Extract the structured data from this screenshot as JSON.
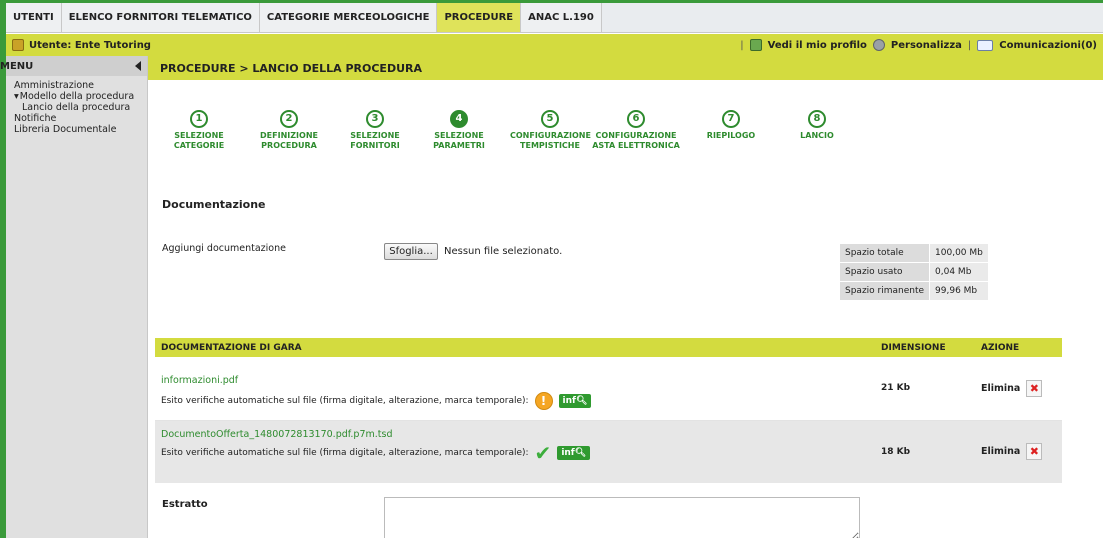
{
  "topnav": {
    "tabs": [
      {
        "label": "UTENTI",
        "active": false
      },
      {
        "label": "ELENCO FORNITORI TELEMATICO",
        "active": false
      },
      {
        "label": "CATEGORIE MERCEOLOGICHE",
        "active": false
      },
      {
        "label": "PROCEDURE",
        "active": true
      },
      {
        "label": "ANAC L.190",
        "active": false
      }
    ]
  },
  "userbar": {
    "user": "Utente: Ente Tutoring",
    "profile_link": "Vedi il mio profilo",
    "customize_link": "Personalizza",
    "messages_link": "Comunicazioni(0)",
    "separator": "|"
  },
  "sidebar": {
    "title": "MENU",
    "items": [
      {
        "label": "Amministrazione"
      },
      {
        "label": "Modello della procedura"
      },
      {
        "label": "Lancio della procedura"
      },
      {
        "label": "Notifiche"
      },
      {
        "label": "Libreria Documentale"
      }
    ]
  },
  "breadcrumb": "PROCEDURE  > LANCIO DELLA PROCEDURA",
  "steps": [
    {
      "num": "1",
      "label": "SELEZIONE CATEGORIE"
    },
    {
      "num": "2",
      "label": "DEFINIZIONE PROCEDURA"
    },
    {
      "num": "3",
      "label": "SELEZIONE FORNITORI"
    },
    {
      "num": "4",
      "label": "SELEZIONE PARAMETRI",
      "active": true
    },
    {
      "num": "5",
      "label": "CONFIGURAZIONE TEMPISTICHE"
    },
    {
      "num": "6",
      "label": "CONFIGURAZIONE ASTA ELETTRONICA"
    },
    {
      "num": "7",
      "label": "RIEPILOGO"
    },
    {
      "num": "8",
      "label": "LANCIO"
    }
  ],
  "documentation": {
    "title": "Documentazione",
    "add_label": "Aggiungi documentazione",
    "browse_button": "Sfoglia...",
    "file_status": "Nessun file selezionato."
  },
  "space": {
    "rows": [
      {
        "key": "Spazio totale",
        "value": "100,00 Mb"
      },
      {
        "key": "Spazio usato",
        "value": "0,04 Mb"
      },
      {
        "key": "Spazio rimanente",
        "value": "99,96 Mb"
      }
    ]
  },
  "docs_table": {
    "headers": [
      "DOCUMENTAZIONE DI GARA",
      "DIMENSIONE",
      "AZIONE"
    ],
    "rows": [
      {
        "filename": "informazioni.pdf",
        "esito": "Esito verifiche automatiche sul file (firma digitale, alterazione, marca temporale):",
        "status": "warning",
        "info": "inf",
        "size": "21 Kb",
        "action": "Elimina"
      },
      {
        "filename": "DocumentoOfferta_1480072813170.pdf.p7m.tsd",
        "esito": "Esito verifiche automatiche sul file (firma digitale, alterazione, marca temporale):",
        "status": "ok",
        "info": "inf",
        "size": "18 Kb",
        "action": "Elimina"
      }
    ]
  },
  "estratto": {
    "label": "Estratto",
    "value": ""
  },
  "colors": {
    "accent_yellow": "#d3db3f",
    "green": "#2e8b2e",
    "frame_green": "#3a9a3a"
  }
}
